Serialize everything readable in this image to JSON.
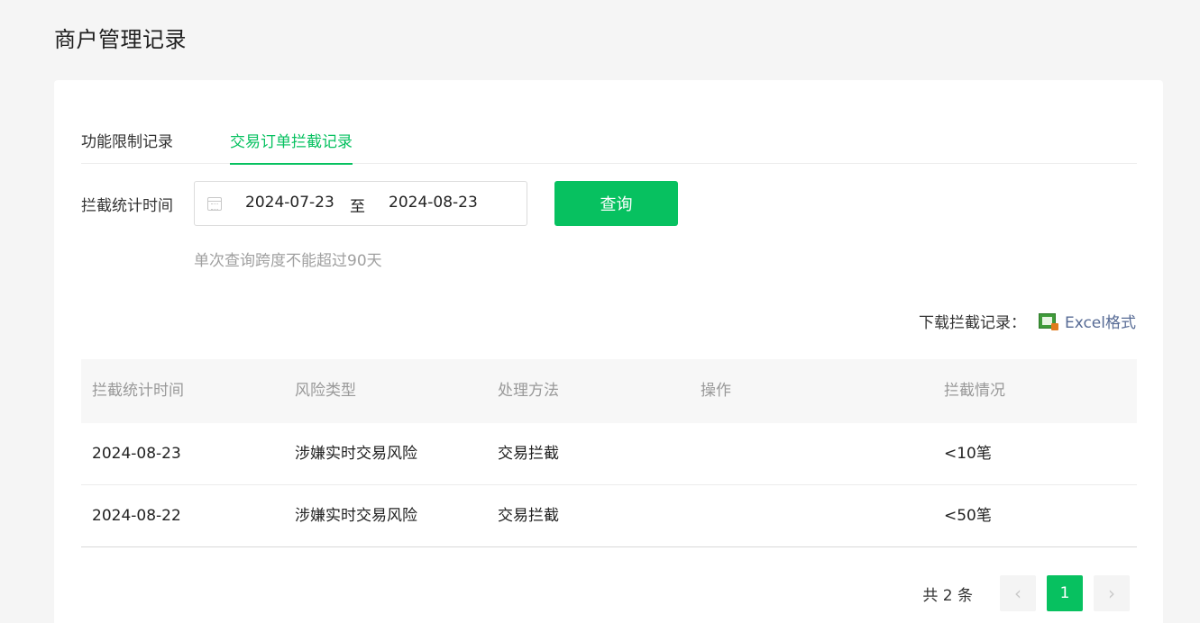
{
  "page": {
    "title": "商户管理记录"
  },
  "tabs": [
    {
      "label": "功能限制记录",
      "active": false
    },
    {
      "label": "交易订单拦截记录",
      "active": true
    }
  ],
  "filter": {
    "label": "拦截统计时间",
    "start_date": "2024-07-23",
    "separator": "至",
    "end_date": "2024-08-23",
    "query_label": "查询",
    "hint": "单次查询跨度不能超过90天"
  },
  "download": {
    "label": "下载拦截记录：",
    "icon": "excel-icon",
    "link_label": "Excel格式"
  },
  "table": {
    "headers": [
      "拦截统计时间",
      "风险类型",
      "处理方法",
      "操作",
      "拦截情况"
    ],
    "rows": [
      [
        "2024-08-23",
        "涉嫌实时交易风险",
        "交易拦截",
        "",
        "<10笔"
      ],
      [
        "2024-08-22",
        "涉嫌实时交易风险",
        "交易拦截",
        "",
        "<50笔"
      ]
    ]
  },
  "pagination": {
    "total_label": "共 2 条",
    "prev_icon": "‹",
    "current_page": "1",
    "next_icon": "›"
  },
  "colors": {
    "accent": "#07c160",
    "link": "#576b95",
    "background": "#f5f5f5"
  }
}
